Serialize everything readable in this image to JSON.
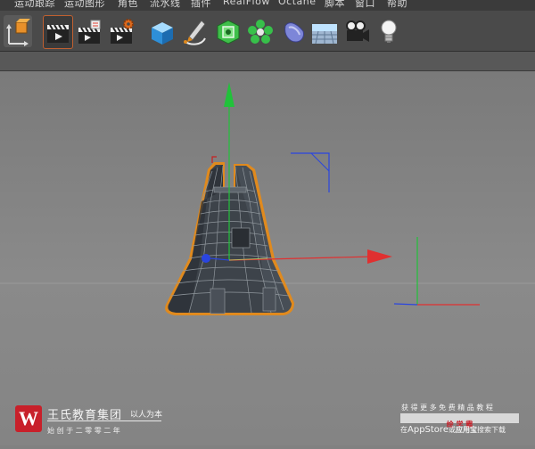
{
  "menubar": {
    "items": [
      {
        "label": "运动跟踪"
      },
      {
        "label": "运动图形"
      },
      {
        "label": "角色"
      },
      {
        "label": "流水线"
      },
      {
        "label": "插件"
      },
      {
        "label": "RealFlow"
      },
      {
        "label": "Octane"
      },
      {
        "label": "脚本"
      },
      {
        "label": "窗口"
      },
      {
        "label": "帮助"
      }
    ]
  },
  "toolbar": {
    "buttons": [
      {
        "icon": "coordinate-system-icon"
      },
      {
        "icon": "render-view-icon"
      },
      {
        "icon": "render-to-picture-viewer-icon"
      },
      {
        "icon": "render-settings-icon"
      },
      {
        "icon": "cube-primitive-icon"
      },
      {
        "icon": "pen-spline-icon"
      },
      {
        "icon": "subdivision-surface-icon"
      },
      {
        "icon": "cloner-icon"
      },
      {
        "icon": "deformer-icon"
      },
      {
        "icon": "floor-environment-icon"
      },
      {
        "icon": "camera-icon"
      },
      {
        "icon": "light-icon"
      }
    ]
  },
  "watermark": {
    "logo_letter": "W",
    "company": "王氏教育集团",
    "motto": "以人为本",
    "founded": "始 创 于 二 零 零 二 年",
    "promo_line1": "获 得 更 多 免 费 精 品 教 程",
    "promo_brand": "绘 学 霸",
    "promo_line3_pre": "在",
    "promo_line3_store": "AppStore",
    "promo_line3_mid": "或",
    "promo_line3_app": "应用宝",
    "promo_line3_post": "搜索下载"
  },
  "colors": {
    "menubar_bg": "#3b3b3b",
    "toolbar_bg": "#4a4a4a",
    "viewport_bg": "#818181",
    "selection_outline": "#e08a1e",
    "axis_x": "#e03030",
    "axis_y": "#21c23a",
    "axis_z": "#2a45e0",
    "logo_red": "#c8202a"
  }
}
